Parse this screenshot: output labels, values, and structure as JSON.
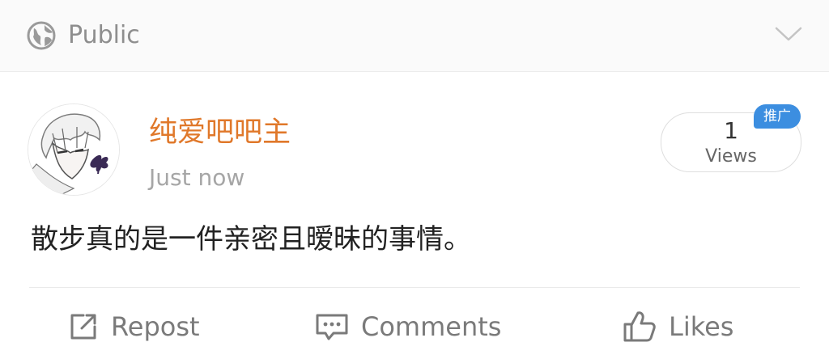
{
  "header": {
    "visibility_label": "Public",
    "visibility_icon": "globe-icon",
    "expand_icon": "chevron-down-icon"
  },
  "post": {
    "author": "纯爱吧吧主",
    "timestamp": "Just now",
    "views_count": "1",
    "views_label": "Views",
    "promo_badge": "推广",
    "text": "散步真的是一件亲密且暧昧的事情。"
  },
  "actions": {
    "repost": "Repost",
    "comments": "Comments",
    "likes": "Likes"
  },
  "colors": {
    "author": "#e0782a",
    "badge": "#3c8ee0",
    "muted": "#7a7a7a"
  }
}
